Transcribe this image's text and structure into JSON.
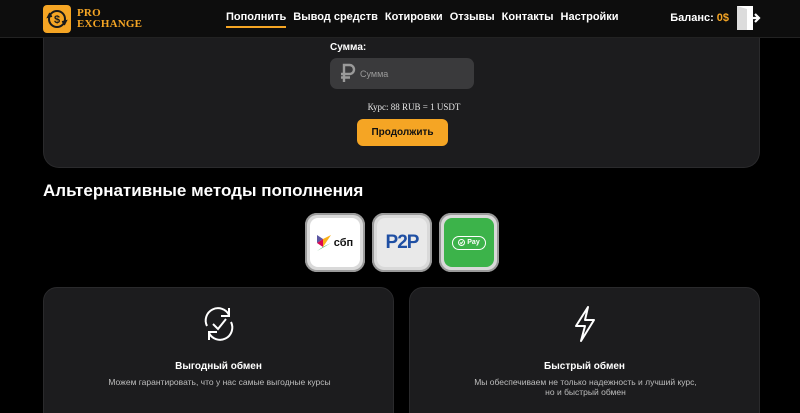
{
  "header": {
    "logo_line1": "PRO",
    "logo_line2": "EXCHANGE",
    "nav": [
      "Пополнить",
      "Вывод средств",
      "Котировки",
      "Отзывы",
      "Контакты",
      "Настройки"
    ],
    "active_nav": "Пополнить",
    "balance_label": "Баланс:",
    "balance_value": "0$"
  },
  "deposit": {
    "sum_label": "Сумма:",
    "sum_placeholder": "Сумма",
    "rate": "Курс: 88 RUB = 1 USDT",
    "continue_label": "Продолжить"
  },
  "alternative": {
    "title": "Альтернативные методы пополнения",
    "methods": [
      {
        "name": "sbp",
        "label": "сбп"
      },
      {
        "name": "p2p",
        "label": "P2P"
      },
      {
        "name": "pay",
        "label": "Pay"
      }
    ]
  },
  "features": [
    {
      "icon": "exchange-cycle-icon",
      "title": "Выгодный обмен",
      "description": "Можем гарантировать, что у нас самые выгодные курсы"
    },
    {
      "icon": "lightning-icon",
      "title": "Быстрый обмен",
      "description": "Мы обеспечиваем не только надежность и лучший курс, но и быстрый обмен"
    }
  ],
  "colors": {
    "accent": "#f5a524",
    "card": "#1c1c1e",
    "background": "#000000"
  }
}
